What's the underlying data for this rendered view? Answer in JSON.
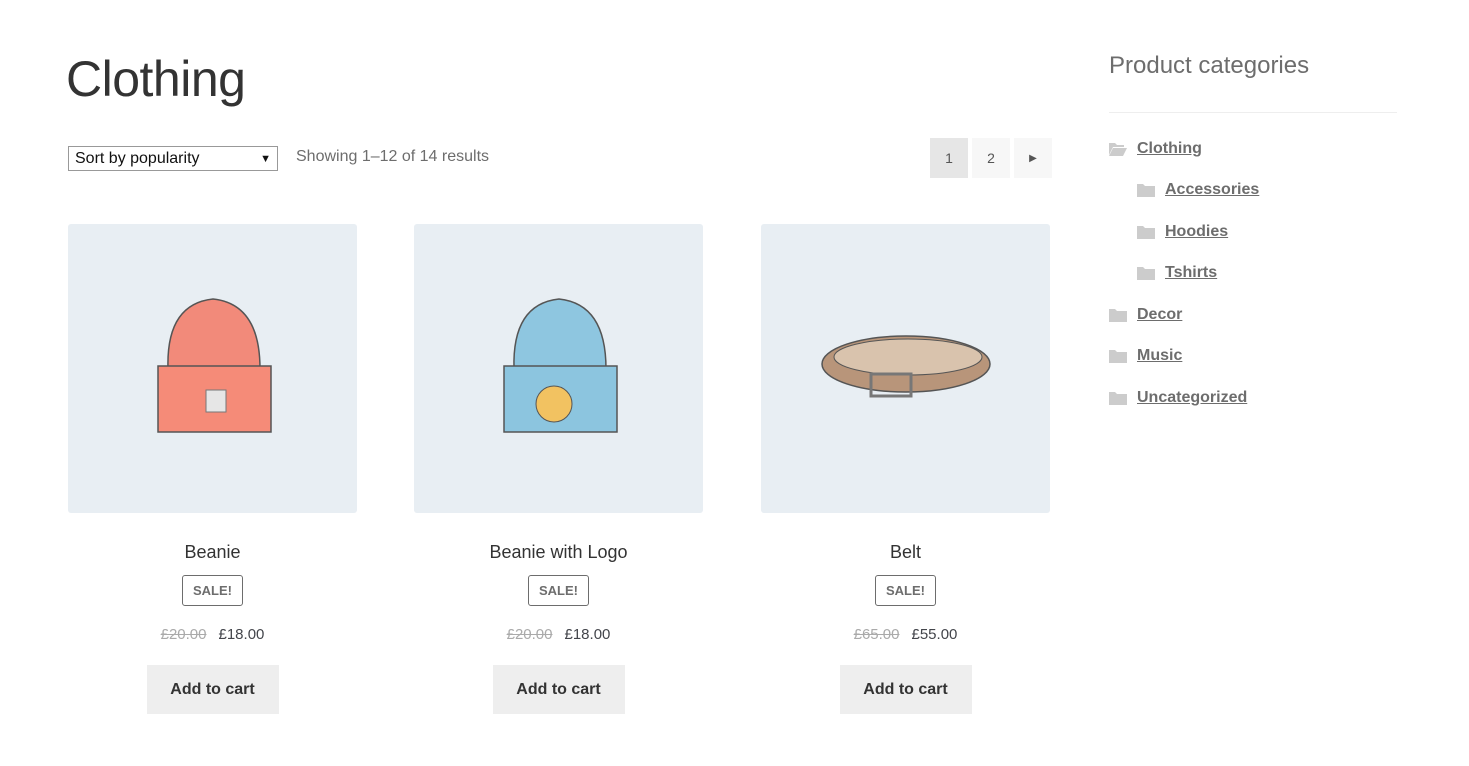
{
  "page_title": "Clothing",
  "sort": {
    "selected": "Sort by popularity"
  },
  "result_count": "Showing 1–12 of 14 results",
  "pagination": {
    "pages": [
      "1",
      "2"
    ],
    "current": "1",
    "next_icon": "triangle-right-icon"
  },
  "products": [
    {
      "name": "Beanie",
      "badge": "SALE!",
      "old_price": "£20.00",
      "price": "£18.00",
      "button": "Add to cart",
      "color": "#f28a7a"
    },
    {
      "name": "Beanie with Logo",
      "badge": "SALE!",
      "old_price": "£20.00",
      "price": "£18.00",
      "button": "Add to cart",
      "color": "#8ec6e0"
    },
    {
      "name": "Belt",
      "badge": "SALE!",
      "old_price": "£65.00",
      "price": "£55.00",
      "button": "Add to cart",
      "color": "#c4a588"
    }
  ],
  "sidebar": {
    "heading": "Product categories",
    "categories": [
      {
        "label": "Clothing",
        "icon": "folder-open-icon"
      },
      {
        "label": "Accessories",
        "icon": "folder-icon"
      },
      {
        "label": "Hoodies",
        "icon": "folder-icon"
      },
      {
        "label": "Tshirts",
        "icon": "folder-icon"
      },
      {
        "label": "Decor",
        "icon": "folder-icon"
      },
      {
        "label": "Music",
        "icon": "folder-icon"
      },
      {
        "label": "Uncategorized",
        "icon": "folder-icon"
      }
    ]
  }
}
